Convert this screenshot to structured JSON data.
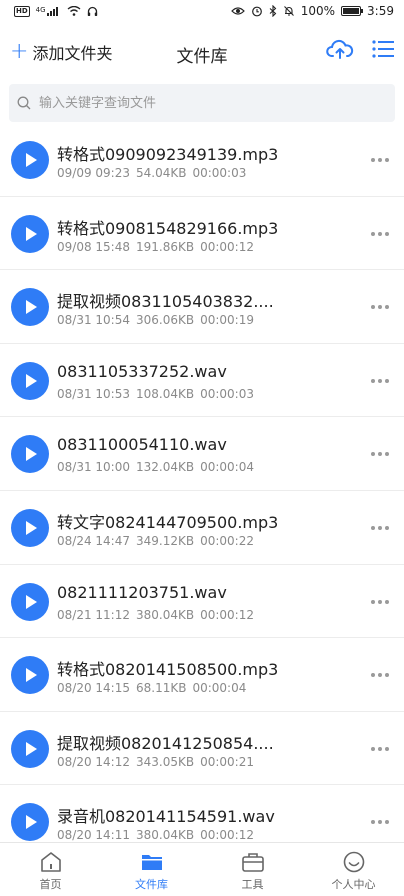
{
  "status_bar": {
    "hd": "HD",
    "signal": "4G",
    "battery_text": "100%",
    "battery_level": 1.0,
    "time": "3:59"
  },
  "header": {
    "add_folder_label": "添加文件夹",
    "title": "文件库"
  },
  "search": {
    "placeholder": "输入关键字查询文件"
  },
  "files": [
    {
      "name": "转格式0909092349139.mp3",
      "date": "09/09 09:23",
      "size": "54.04KB",
      "duration": "00:00:03"
    },
    {
      "name": "转格式0908154829166.mp3",
      "date": "09/08 15:48",
      "size": "191.86KB",
      "duration": "00:00:12"
    },
    {
      "name": "提取视频0831105403832....",
      "date": "08/31 10:54",
      "size": "306.06KB",
      "duration": "00:00:19"
    },
    {
      "name": "0831105337252.wav",
      "date": "08/31 10:53",
      "size": "108.04KB",
      "duration": "00:00:03"
    },
    {
      "name": "0831100054110.wav",
      "date": "08/31 10:00",
      "size": "132.04KB",
      "duration": "00:00:04"
    },
    {
      "name": "转文字0824144709500.mp3",
      "date": "08/24 14:47",
      "size": "349.12KB",
      "duration": "00:00:22"
    },
    {
      "name": "0821111203751.wav",
      "date": "08/21 11:12",
      "size": "380.04KB",
      "duration": "00:00:12"
    },
    {
      "name": "转格式0820141508500.mp3",
      "date": "08/20 14:15",
      "size": "68.11KB",
      "duration": "00:00:04"
    },
    {
      "name": "提取视频0820141250854....",
      "date": "08/20 14:12",
      "size": "343.05KB",
      "duration": "00:00:21"
    },
    {
      "name": "录音机0820141154591.wav",
      "date": "08/20 14:11",
      "size": "380.04KB",
      "duration": "00:00:12"
    }
  ],
  "bottom_nav": [
    {
      "label": "首页",
      "icon": "home-icon",
      "active": false
    },
    {
      "label": "文件库",
      "icon": "folder-icon",
      "active": true
    },
    {
      "label": "工具",
      "icon": "toolbox-icon",
      "active": false
    },
    {
      "label": "个人中心",
      "icon": "smiley-icon",
      "active": false
    }
  ],
  "colors": {
    "accent": "#2f7cf6",
    "text_primary": "#222222",
    "text_secondary": "#8a8a8a"
  }
}
